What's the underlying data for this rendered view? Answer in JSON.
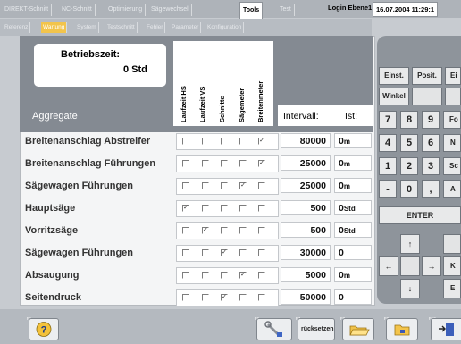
{
  "top_tabs": [
    {
      "label": "DIREKT-Schnitt",
      "active": false
    },
    {
      "label": "NC-Schnitt",
      "active": false
    },
    {
      "label": "Optimierung",
      "active": false
    },
    {
      "label": "Sägewechsel",
      "active": false
    },
    {
      "label": "Tools",
      "active": true
    },
    {
      "label": "Test",
      "active": false
    }
  ],
  "login": "Login Ebene1",
  "datetime": "16.07.2004  11:29:1",
  "sub_tabs": [
    {
      "label": "Referenz",
      "active": false
    },
    {
      "label": "Wartung",
      "active": true
    },
    {
      "label": "System",
      "active": false
    },
    {
      "label": "Testschnitt",
      "active": false
    },
    {
      "label": "Fehler",
      "active": false
    },
    {
      "label": "Parameter",
      "active": false
    },
    {
      "label": "Konfiguration",
      "active": false
    }
  ],
  "betriebszeit": {
    "label": "Betriebszeit:",
    "value": "0 Std"
  },
  "columns": [
    "Laufzeit HS",
    "Laufzeit VS",
    "Schnitte",
    "Sägemeter",
    "Breitenmeter"
  ],
  "aggregate_label": "Aggregate",
  "intervall_label": "Intervall:",
  "ist_label": "Ist:",
  "rows": [
    {
      "name": "Breitenanschlag Abstreifer",
      "checks": [
        false,
        false,
        false,
        false,
        true
      ],
      "intervall": "80000",
      "ist": "0",
      "unit": "m"
    },
    {
      "name": "Breitenanschlag Führungen",
      "checks": [
        false,
        false,
        false,
        false,
        true
      ],
      "intervall": "25000",
      "ist": "0",
      "unit": "m"
    },
    {
      "name": "Sägewagen Führungen",
      "checks": [
        false,
        false,
        false,
        true,
        false
      ],
      "intervall": "25000",
      "ist": "0",
      "unit": "m"
    },
    {
      "name": "Hauptsäge",
      "checks": [
        true,
        false,
        false,
        false,
        false
      ],
      "intervall": "500",
      "ist": "0",
      "unit": "Std"
    },
    {
      "name": "Vorritzsäge",
      "checks": [
        false,
        true,
        false,
        false,
        false
      ],
      "intervall": "500",
      "ist": "0",
      "unit": "Std"
    },
    {
      "name": "Sägewagen Führungen",
      "checks": [
        false,
        false,
        true,
        false,
        false
      ],
      "intervall": "30000",
      "ist": "0",
      "unit": ""
    },
    {
      "name": "Absaugung",
      "checks": [
        false,
        false,
        false,
        true,
        false
      ],
      "intervall": "5000",
      "ist": "0",
      "unit": "m"
    },
    {
      "name": "Seitendruck",
      "checks": [
        false,
        false,
        true,
        false,
        false
      ],
      "intervall": "50000",
      "ist": "0",
      "unit": ""
    }
  ],
  "keypad": {
    "einst": "Einst.",
    "posit": "Posit.",
    "e_partial": "Ei",
    "winkel": "Winkel",
    "digits_row1": [
      "7",
      "8",
      "9"
    ],
    "digits_row2": [
      "4",
      "5",
      "6"
    ],
    "digits_row3": [
      "1",
      "2",
      "3"
    ],
    "digits_row4": [
      "-",
      "0",
      ","
    ],
    "side_keys": [
      "Fo",
      "N",
      "Sc",
      "A"
    ],
    "enter": "ENTER",
    "k_partial": "K",
    "e2_partial": "E",
    "arrow_up": "↑",
    "arrow_down": "↓",
    "arrow_left": "←",
    "arrow_right": "→"
  },
  "function_keys": {
    "f1": "F1",
    "f6": "F6",
    "f7": "F7",
    "f7_text": "rücksetzen",
    "f8": "F8",
    "f9": "F9",
    "f10": "F10"
  },
  "colors": {
    "accent_tab": "#f2c44c",
    "header_gray": "#848a92",
    "keypad_gray": "#8e949b"
  }
}
